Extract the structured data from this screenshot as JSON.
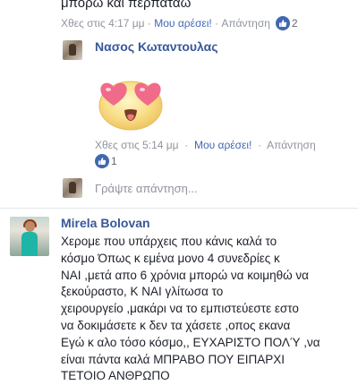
{
  "top_comment": {
    "text_tail": "μπορώ και περπατάω",
    "time": "Χθες στις 4:17 μμ",
    "like_label": "Μου αρέσει!",
    "reply_label": "Απάντηση",
    "like_count": "2"
  },
  "reply": {
    "author": "Νασος Κωταντουλας",
    "sticker": "heart-eyes-emoji",
    "time": "Χθες στις 5:14 μμ",
    "like_label": "Μου αρέσει!",
    "reply_label": "Απάντηση",
    "like_count": "1"
  },
  "reply_box": {
    "placeholder": "Γράψτε απάντηση..."
  },
  "main_comment": {
    "author": "Mirela Bolovan",
    "lines": [
      "Χερομε που υπάρχεις που κάνις καλά το",
      "κόσμο Όπως κ εμένα μονο 4 συνεδρίες κ",
      "ΝΑΙ ,μετά απο 6 χρόνια μπορώ να κοιμηθώ  να",
      "ξεκούραστο, Κ ΝΑΙ γλίτωσα το",
      "χειρουργείο ,μακάρι να το εμπιστεύεστε εστο",
      "να δοκιμάσετε κ δεν τα χάσετε ,οπος εκανα",
      "Εγώ κ αλο τόσο κόσμο,, ΕΥΧΑΡΙΣΤΟ ΠΟΛΎ ,να",
      "είναι πάντα καλά    ΜΠΡΑΒΟ ΠΟΥ ΕΙΠΑΡΧΙ",
      "ΤΕΤΟΙΟ ΑΝΘΡΩΠΟ"
    ]
  },
  "colors": {
    "link": "#4267b2",
    "name": "#385898",
    "meta": "#90949c"
  }
}
